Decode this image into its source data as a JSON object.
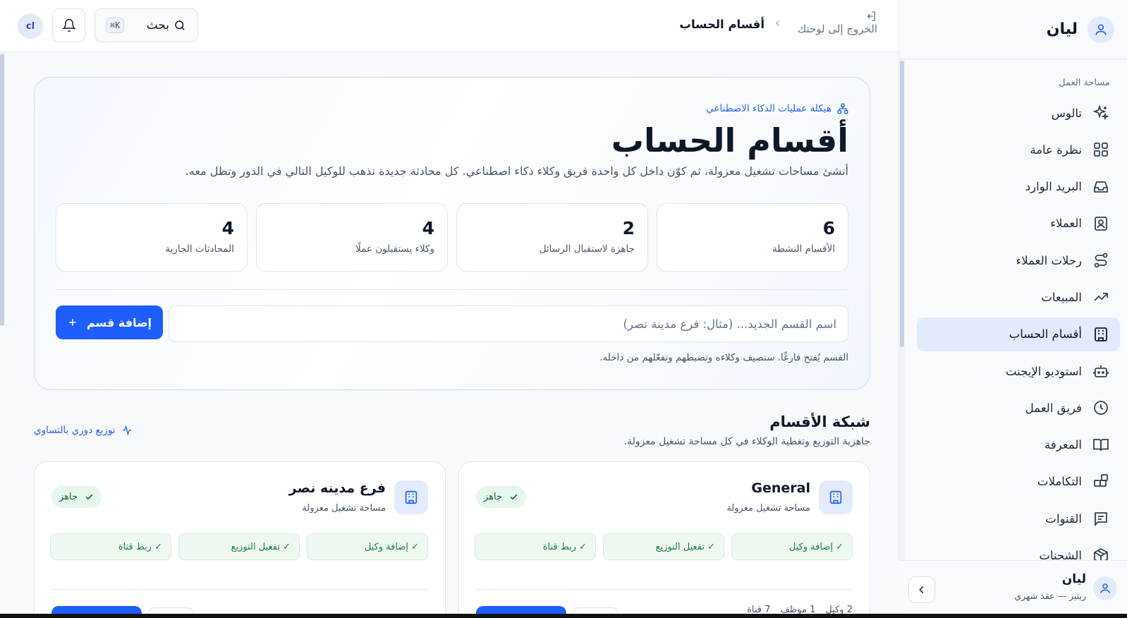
{
  "sidebar": {
    "brand": "ليان",
    "section_label": "مساحة العمل",
    "items": [
      {
        "label": "تالوس",
        "icon": "sparkles-icon"
      },
      {
        "label": "نظرة عامة",
        "icon": "grid-icon"
      },
      {
        "label": "البريد الوارد",
        "icon": "inbox-icon"
      },
      {
        "label": "العملاء",
        "icon": "contact-icon"
      },
      {
        "label": "رحلات العملاء",
        "icon": "route-icon"
      },
      {
        "label": "المبيعات",
        "icon": "trend-up-icon"
      },
      {
        "label": "أقسام الحساب",
        "icon": "building-icon",
        "active": true
      },
      {
        "label": "استوديو الإيجنت",
        "icon": "bot-icon"
      },
      {
        "label": "فريق العمل",
        "icon": "clock-icon"
      },
      {
        "label": "المعرفة",
        "icon": "book-icon"
      },
      {
        "label": "التكاملات",
        "icon": "blocks-icon"
      },
      {
        "label": "القنوات",
        "icon": "message-square-icon"
      },
      {
        "label": "الشحنات",
        "icon": "package-icon"
      }
    ],
    "footer": {
      "name": "ليان",
      "plan": "ريتيز — عقد شهري"
    }
  },
  "topbar": {
    "user_initials": "cl",
    "search_label": "بحث",
    "search_shortcut": "K⌘",
    "exit_label": "الخروج إلى لوحتك",
    "breadcrumb_current": "أقسام الحساب"
  },
  "hero": {
    "eyebrow": "هيكلة عمليات الذكاء الاصطناعي",
    "title": "أقسام الحساب",
    "description": "أنشئ مساحات تشغيل معزولة، ثم كوّن داخل كل واحدة فريق وكلاء ذكاء اصطناعي. كل محادثة جديدة تذهب للوكيل التالي في الدور وتظل معه.",
    "stats": [
      {
        "value": "6",
        "label": "الأقسام النشطة"
      },
      {
        "value": "2",
        "label": "جاهزة لاستقبال الرسائل"
      },
      {
        "value": "4",
        "label": "وكلاء يستقبلون عملًا"
      },
      {
        "value": "4",
        "label": "المحادثات الجارية"
      }
    ],
    "input_placeholder": "اسم القسم الجديد... (مثال: فرع مدينة نصر)",
    "add_button": "إضافة قسم",
    "hint": "القسم يُفتح فارغًا. ستضيف وكلاءه وتضبطهم وتفعّلهم من داخله."
  },
  "grid": {
    "title": "شبكة الأقسام",
    "subtitle": "جاهزية التوزيع وتغطية الوكلاء في كل مساحة تشغيل معزولة.",
    "round_robin": "توزيع دوري بالتساوي",
    "cards": [
      {
        "name": "General",
        "kind": "مساحة تشغيل معزولة",
        "status": "جاهز",
        "steps": [
          "✓ إضافة وكيل",
          "✓ تفعيل التوزيع",
          "✓ ربط قناة"
        ],
        "meta": [
          "2 وكيل",
          "1 موظف",
          "7 قناة"
        ]
      },
      {
        "name": "فرع مدينه نصر",
        "kind": "مساحة تشغيل معزولة",
        "status": "جاهز",
        "steps": [
          "✓ إضافة وكيل",
          "✓ تفعيل التوزيع",
          "✓ ربط قناة"
        ]
      }
    ]
  },
  "colors": {
    "accent": "#1e5eff",
    "active_nav": "#e2eafd",
    "success_bg": "#e5f6ec",
    "success_text": "#166534"
  }
}
